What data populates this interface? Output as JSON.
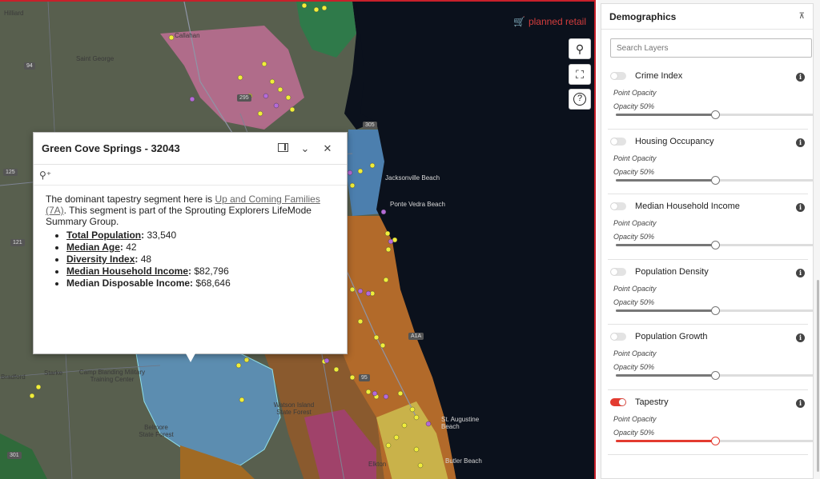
{
  "brand": {
    "name": "planned retail",
    "icon": "shopping-cart-icon",
    "color": "#d43d3d"
  },
  "map": {
    "controls": [
      {
        "name": "search-map-button",
        "icon": "search-icon",
        "glyph": "🔍"
      },
      {
        "name": "fullscreen-button",
        "icon": "fullscreen-icon",
        "glyph": "⛶"
      },
      {
        "name": "help-button",
        "icon": "help-icon",
        "glyph": "?"
      }
    ],
    "labels": [
      "Callahan",
      "Saint George",
      "Hilliard",
      "Jacksonville Beach",
      "Ponte Vedra Beach",
      "Camp Blanding Military Training Center",
      "Starke",
      "Bradford",
      "Belmore State Forest",
      "Watson Island State Forest",
      "St. Augustine Beach",
      "Butler Beach",
      "Elkton"
    ],
    "shields": [
      "94",
      "125",
      "121",
      "301",
      "305",
      "A1A",
      "95",
      "295"
    ]
  },
  "popup": {
    "title": "Green Cove Springs - 32043",
    "dock_icon": "dock-icon",
    "collapse_icon": "chevron-down-icon",
    "close_icon": "close-icon",
    "zoom_icon": "zoom-in-icon",
    "intro": "The dominant tapestry segment here is ",
    "segment_link": "Up and Coming Families (7A)",
    "outro": ". This segment is part of the Sprouting Explorers LifeMode Summary Group.",
    "stats": [
      {
        "label": "Total Population",
        "value": "33,540"
      },
      {
        "label": "Median Age",
        "value": "42"
      },
      {
        "label": "Diversity Index",
        "value": "48"
      },
      {
        "label": "Median Household Income",
        "value": "$82,796"
      },
      {
        "label": "Median Disposable Income",
        "value": "$68,646"
      }
    ]
  },
  "sidebar": {
    "title": "Demographics",
    "collapse_icon": "collapse-up-icon",
    "search_placeholder": "Search Layers",
    "layers": [
      {
        "name": "Crime Index",
        "enabled": false,
        "point_opacity_label": "Point Opacity",
        "opacity_label": "Opacity 50%",
        "opacity": 0.5
      },
      {
        "name": "Housing Occupancy",
        "enabled": false,
        "point_opacity_label": "Point Opacity",
        "opacity_label": "Opacity 50%",
        "opacity": 0.5
      },
      {
        "name": "Median Household Income",
        "enabled": false,
        "point_opacity_label": "Point Opacity",
        "opacity_label": "Opacity 50%",
        "opacity": 0.5
      },
      {
        "name": "Population Density",
        "enabled": false,
        "point_opacity_label": "Point Opacity",
        "opacity_label": "Opacity 50%",
        "opacity": 0.5
      },
      {
        "name": "Population Growth",
        "enabled": false,
        "point_opacity_label": "Point Opacity",
        "opacity_label": "Opacity 50%",
        "opacity": 0.5
      },
      {
        "name": "Tapestry",
        "enabled": true,
        "point_opacity_label": "Point Opacity",
        "opacity_label": "Opacity 50%",
        "opacity": 0.5
      }
    ],
    "accent": "#e33b30"
  }
}
